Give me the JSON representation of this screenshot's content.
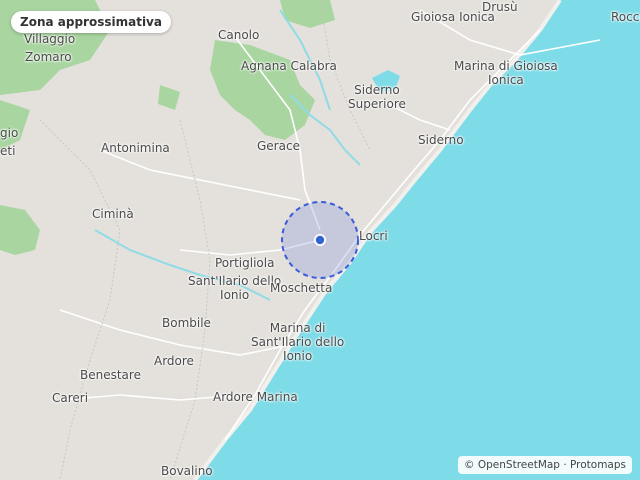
{
  "badge": {
    "label": "Zona approssimativa"
  },
  "attribution": {
    "text": "© OpenStreetMap · Protomaps"
  },
  "colors": {
    "sea": "#7edbe8",
    "land": "#e4e1dc",
    "forest": "#a8d5a0",
    "accuracy_ring": "#3b5bdb",
    "location_dot": "#2f63d6"
  },
  "places": [
    {
      "id": "drusu",
      "lines": [
        "Drusù"
      ]
    },
    {
      "id": "gioiosa-ionica",
      "lines": [
        "Gioiosa Ionica"
      ]
    },
    {
      "id": "rocce",
      "lines": [
        "Rocce"
      ]
    },
    {
      "id": "canolo",
      "lines": [
        "Canolo"
      ]
    },
    {
      "id": "villaggio",
      "lines": [
        "Villaggio"
      ]
    },
    {
      "id": "zomaro",
      "lines": [
        "Zomaro"
      ]
    },
    {
      "id": "agnana-calabra",
      "lines": [
        "Agnana Calabra"
      ]
    },
    {
      "id": "marina-di-gioiosa-ionica",
      "lines": [
        "Marina di Gioiosa",
        "Ionica"
      ]
    },
    {
      "id": "siderno-superiore",
      "lines": [
        "Siderno",
        "Superiore"
      ]
    },
    {
      "id": "gio",
      "lines": [
        "gio"
      ]
    },
    {
      "id": "eti",
      "lines": [
        "eti"
      ]
    },
    {
      "id": "antonimina",
      "lines": [
        "Antonimina"
      ]
    },
    {
      "id": "gerace",
      "lines": [
        "Gerace"
      ]
    },
    {
      "id": "siderno",
      "lines": [
        "Siderno"
      ]
    },
    {
      "id": "cimina",
      "lines": [
        "Ciminà"
      ]
    },
    {
      "id": "locri",
      "lines": [
        "Locri"
      ]
    },
    {
      "id": "portigliola",
      "lines": [
        "Portigliola"
      ]
    },
    {
      "id": "santilario-dello-ionio",
      "lines": [
        "Sant'Ilario dello",
        "Ionio"
      ]
    },
    {
      "id": "moschetta",
      "lines": [
        "Moschetta"
      ]
    },
    {
      "id": "bombile",
      "lines": [
        "Bombile"
      ]
    },
    {
      "id": "marina-di-santilario",
      "lines": [
        "Marina di",
        "Sant'Ilario dello",
        "Ionio"
      ]
    },
    {
      "id": "ardore",
      "lines": [
        "Ardore"
      ]
    },
    {
      "id": "benestare",
      "lines": [
        "Benestare"
      ]
    },
    {
      "id": "careri",
      "lines": [
        "Careri"
      ]
    },
    {
      "id": "ardore-marina",
      "lines": [
        "Ardore Marina"
      ]
    },
    {
      "id": "bovalino",
      "lines": [
        "Bovalino"
      ]
    }
  ]
}
